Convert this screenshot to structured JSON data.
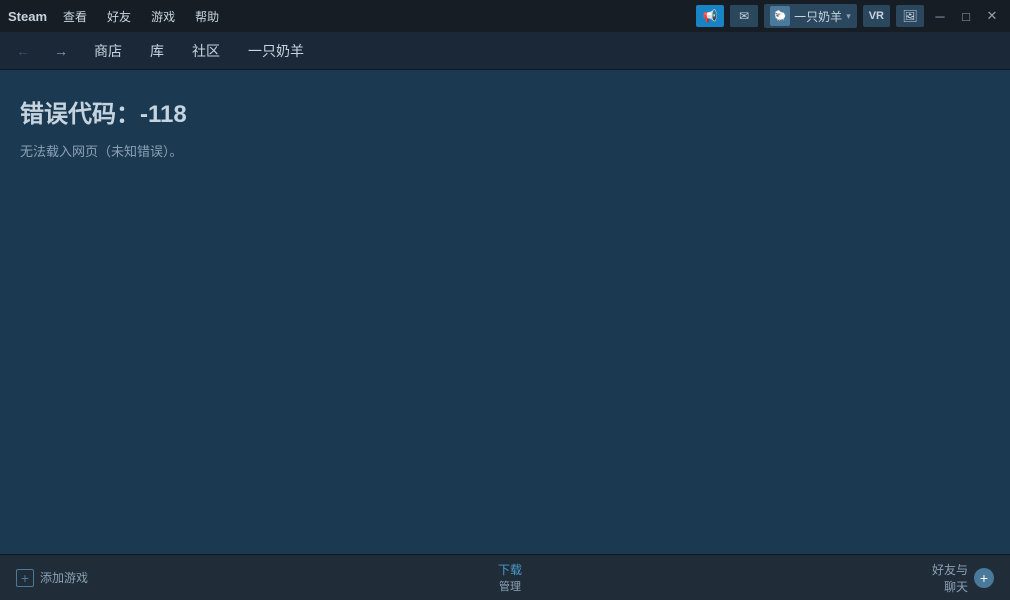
{
  "titlebar": {
    "app_name": "Steam",
    "menu": [
      "查看",
      "好友",
      "游戏",
      "帮助"
    ],
    "user": {
      "name": "一只奶羊",
      "avatar_placeholder": "🐑"
    },
    "vr_label": "VR",
    "screenshot_label": "📷",
    "minimize_symbol": "─",
    "maximize_symbol": "□",
    "close_symbol": "✕"
  },
  "navbar": {
    "back_arrow": "←",
    "forward_arrow": "→",
    "links": [
      "商店",
      "库",
      "社区",
      "一只奶羊"
    ]
  },
  "main": {
    "error_title": "错误代码：-118",
    "error_desc": "无法载入网页（未知错误）。"
  },
  "statusbar": {
    "add_game": "添加游戏",
    "download": "下载",
    "manage": "管理",
    "friends_chat": "好友与\n聊天",
    "plus_symbol": "+"
  }
}
